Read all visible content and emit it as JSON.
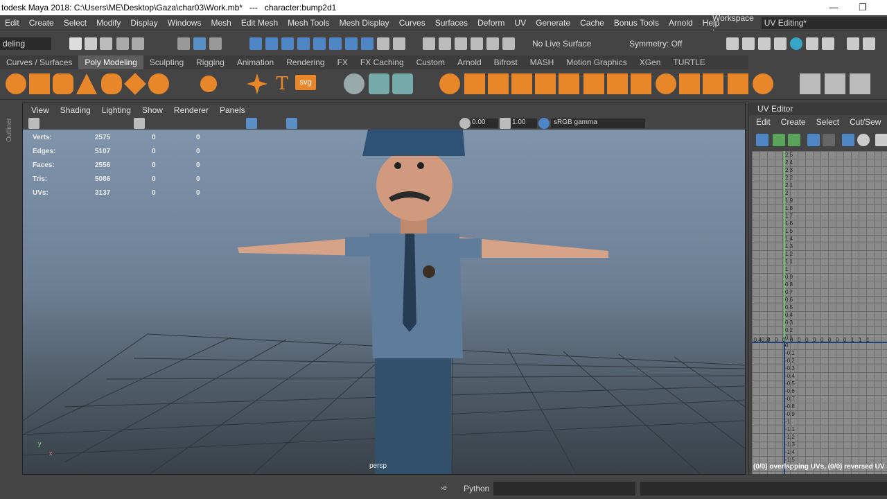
{
  "titlebar": {
    "title": "todesk Maya 2018: C:\\Users\\ME\\Desktop\\Gaza\\char03\\Work.mb*   ---   character:bump2d1",
    "minimize": "—",
    "restore": "❐"
  },
  "menubar": {
    "items": [
      "Edit",
      "Create",
      "Select",
      "Modify",
      "Display",
      "Windows",
      "Mesh",
      "Edit Mesh",
      "Mesh Tools",
      "Mesh Display",
      "Curves",
      "Surfaces",
      "Deform",
      "UV",
      "Generate",
      "Cache",
      "Bonus Tools",
      "Arnold",
      "Help"
    ]
  },
  "workspace": {
    "label": "Workspace :",
    "value": "UV Editing*"
  },
  "statusline": {
    "menuset": "deling",
    "live_surface": "No Live Surface",
    "symmetry": "Symmetry: Off"
  },
  "shelf": {
    "tabs": [
      "Curves / Surfaces",
      "Poly Modeling",
      "Sculpting",
      "Rigging",
      "Animation",
      "Rendering",
      "FX",
      "FX Caching",
      "Custom",
      "Arnold",
      "Bifrost",
      "MASH",
      "Motion Graphics",
      "XGen",
      "TURTLE"
    ],
    "active_tab": "Poly Modeling",
    "text_icon": "T",
    "svg_icon": "svg"
  },
  "outliner_label": "Outliner",
  "viewport": {
    "menu": [
      "View",
      "Shading",
      "Lighting",
      "Show",
      "Renderer",
      "Panels"
    ],
    "exposure": "0.00",
    "gamma": "1.00",
    "color_space": "sRGB gamma",
    "camera": "persp",
    "hud": [
      {
        "label": "Verts:",
        "v1": "2575",
        "v2": "0",
        "v3": "0"
      },
      {
        "label": "Edges:",
        "v1": "5107",
        "v2": "0",
        "v3": "0"
      },
      {
        "label": "Faces:",
        "v1": "2556",
        "v2": "0",
        "v3": "0"
      },
      {
        "label": "Tris:",
        "v1": "5086",
        "v2": "0",
        "v3": "0"
      },
      {
        "label": "UVs:",
        "v1": "3137",
        "v2": "0",
        "v3": "0"
      }
    ],
    "axis_y": "y",
    "axis_x": "x"
  },
  "uv_editor": {
    "title": "UV Editor",
    "menu": [
      "Edit",
      "Create",
      "Select",
      "Cut/Sew"
    ],
    "status": "(0/0) overlapping UVs, (0/0) reversed UV",
    "v_ticks": [
      "2.5",
      "2.4",
      "2.3",
      "2.2",
      "2.1",
      "2",
      "1.9",
      "1.8",
      "1.7",
      "1.6",
      "1.5",
      "1.4",
      "1.3",
      "1.2",
      "1.1",
      "1",
      "0.9",
      "0.8",
      "0.7",
      "0.6",
      "0.5",
      "0.4",
      "0.3",
      "0.2",
      "0.1",
      "0",
      "-0.1",
      "-0.2",
      "-0.3",
      "-0.4",
      "-0.5",
      "-0.6",
      "-0.7",
      "-0.8",
      "-0.9",
      "-1",
      "-1.1",
      "-1.2",
      "-1.3",
      "-1.4",
      "-1.5",
      "-1.6"
    ],
    "u_ticks": [
      "-0.4",
      "-0.3",
      "0",
      "0",
      "0",
      "0",
      "0",
      "0",
      "0",
      "0",
      "0",
      "0",
      "0",
      "1",
      "1",
      "1"
    ]
  },
  "cmdline": {
    "lang": "Python",
    "prompt": "›e"
  }
}
